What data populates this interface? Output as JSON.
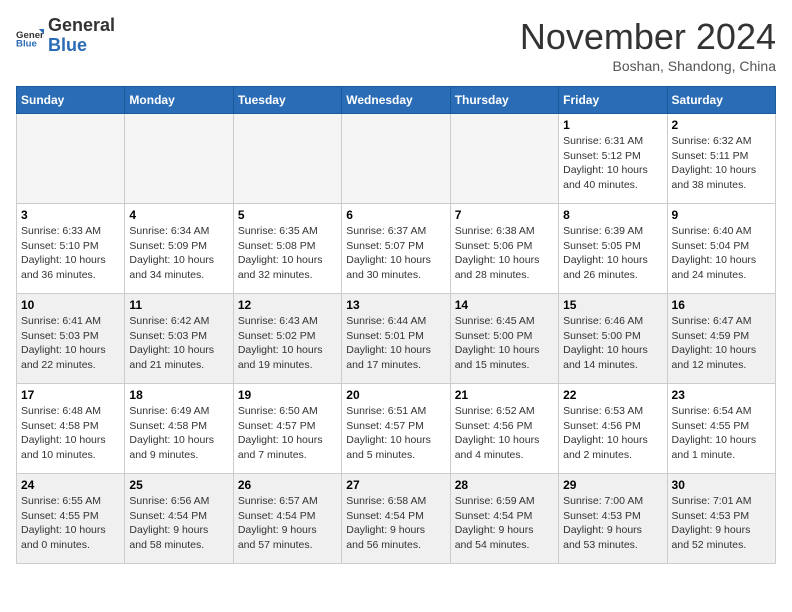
{
  "header": {
    "logo_general": "General",
    "logo_blue": "Blue",
    "month_title": "November 2024",
    "subtitle": "Boshan, Shandong, China"
  },
  "days_of_week": [
    "Sunday",
    "Monday",
    "Tuesday",
    "Wednesday",
    "Thursday",
    "Friday",
    "Saturday"
  ],
  "weeks": [
    [
      {
        "day": "",
        "info": ""
      },
      {
        "day": "",
        "info": ""
      },
      {
        "day": "",
        "info": ""
      },
      {
        "day": "",
        "info": ""
      },
      {
        "day": "",
        "info": ""
      },
      {
        "day": "1",
        "info": "Sunrise: 6:31 AM\nSunset: 5:12 PM\nDaylight: 10 hours\nand 40 minutes."
      },
      {
        "day": "2",
        "info": "Sunrise: 6:32 AM\nSunset: 5:11 PM\nDaylight: 10 hours\nand 38 minutes."
      }
    ],
    [
      {
        "day": "3",
        "info": "Sunrise: 6:33 AM\nSunset: 5:10 PM\nDaylight: 10 hours\nand 36 minutes."
      },
      {
        "day": "4",
        "info": "Sunrise: 6:34 AM\nSunset: 5:09 PM\nDaylight: 10 hours\nand 34 minutes."
      },
      {
        "day": "5",
        "info": "Sunrise: 6:35 AM\nSunset: 5:08 PM\nDaylight: 10 hours\nand 32 minutes."
      },
      {
        "day": "6",
        "info": "Sunrise: 6:37 AM\nSunset: 5:07 PM\nDaylight: 10 hours\nand 30 minutes."
      },
      {
        "day": "7",
        "info": "Sunrise: 6:38 AM\nSunset: 5:06 PM\nDaylight: 10 hours\nand 28 minutes."
      },
      {
        "day": "8",
        "info": "Sunrise: 6:39 AM\nSunset: 5:05 PM\nDaylight: 10 hours\nand 26 minutes."
      },
      {
        "day": "9",
        "info": "Sunrise: 6:40 AM\nSunset: 5:04 PM\nDaylight: 10 hours\nand 24 minutes."
      }
    ],
    [
      {
        "day": "10",
        "info": "Sunrise: 6:41 AM\nSunset: 5:03 PM\nDaylight: 10 hours\nand 22 minutes."
      },
      {
        "day": "11",
        "info": "Sunrise: 6:42 AM\nSunset: 5:03 PM\nDaylight: 10 hours\nand 21 minutes."
      },
      {
        "day": "12",
        "info": "Sunrise: 6:43 AM\nSunset: 5:02 PM\nDaylight: 10 hours\nand 19 minutes."
      },
      {
        "day": "13",
        "info": "Sunrise: 6:44 AM\nSunset: 5:01 PM\nDaylight: 10 hours\nand 17 minutes."
      },
      {
        "day": "14",
        "info": "Sunrise: 6:45 AM\nSunset: 5:00 PM\nDaylight: 10 hours\nand 15 minutes."
      },
      {
        "day": "15",
        "info": "Sunrise: 6:46 AM\nSunset: 5:00 PM\nDaylight: 10 hours\nand 14 minutes."
      },
      {
        "day": "16",
        "info": "Sunrise: 6:47 AM\nSunset: 4:59 PM\nDaylight: 10 hours\nand 12 minutes."
      }
    ],
    [
      {
        "day": "17",
        "info": "Sunrise: 6:48 AM\nSunset: 4:58 PM\nDaylight: 10 hours\nand 10 minutes."
      },
      {
        "day": "18",
        "info": "Sunrise: 6:49 AM\nSunset: 4:58 PM\nDaylight: 10 hours\nand 9 minutes."
      },
      {
        "day": "19",
        "info": "Sunrise: 6:50 AM\nSunset: 4:57 PM\nDaylight: 10 hours\nand 7 minutes."
      },
      {
        "day": "20",
        "info": "Sunrise: 6:51 AM\nSunset: 4:57 PM\nDaylight: 10 hours\nand 5 minutes."
      },
      {
        "day": "21",
        "info": "Sunrise: 6:52 AM\nSunset: 4:56 PM\nDaylight: 10 hours\nand 4 minutes."
      },
      {
        "day": "22",
        "info": "Sunrise: 6:53 AM\nSunset: 4:56 PM\nDaylight: 10 hours\nand 2 minutes."
      },
      {
        "day": "23",
        "info": "Sunrise: 6:54 AM\nSunset: 4:55 PM\nDaylight: 10 hours\nand 1 minute."
      }
    ],
    [
      {
        "day": "24",
        "info": "Sunrise: 6:55 AM\nSunset: 4:55 PM\nDaylight: 10 hours\nand 0 minutes."
      },
      {
        "day": "25",
        "info": "Sunrise: 6:56 AM\nSunset: 4:54 PM\nDaylight: 9 hours\nand 58 minutes."
      },
      {
        "day": "26",
        "info": "Sunrise: 6:57 AM\nSunset: 4:54 PM\nDaylight: 9 hours\nand 57 minutes."
      },
      {
        "day": "27",
        "info": "Sunrise: 6:58 AM\nSunset: 4:54 PM\nDaylight: 9 hours\nand 56 minutes."
      },
      {
        "day": "28",
        "info": "Sunrise: 6:59 AM\nSunset: 4:54 PM\nDaylight: 9 hours\nand 54 minutes."
      },
      {
        "day": "29",
        "info": "Sunrise: 7:00 AM\nSunset: 4:53 PM\nDaylight: 9 hours\nand 53 minutes."
      },
      {
        "day": "30",
        "info": "Sunrise: 7:01 AM\nSunset: 4:53 PM\nDaylight: 9 hours\nand 52 minutes."
      }
    ]
  ]
}
